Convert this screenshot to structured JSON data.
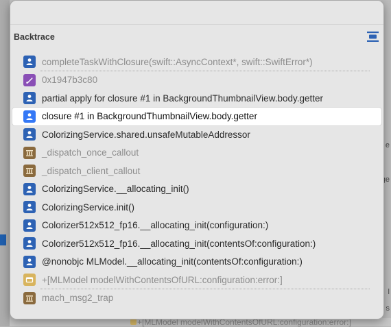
{
  "background": {
    "right_hints": [
      "e",
      "ge",
      "l",
      "s"
    ],
    "bottom_hint": "+[MLModel modelWithContentsOfURL:configuration:error:]"
  },
  "panel": {
    "title": "Backtrace",
    "toggle_icon": "expand-collapse-icon"
  },
  "frames": [
    {
      "label": "completeTaskWithClosure(swift::AsyncContext*, swift::SwiftError*)",
      "kind": "user",
      "dimmed": true,
      "separator_after": true
    },
    {
      "label": "0x1947b3c80",
      "kind": "asm",
      "dimmed": true
    },
    {
      "label": "partial apply for closure #1 in BackgroundThumbnailView.body.getter",
      "kind": "user",
      "dimmed": false
    },
    {
      "label": "closure #1 in BackgroundThumbnailView.body.getter",
      "kind": "user",
      "dimmed": false,
      "selected": true
    },
    {
      "label": "ColorizingService.shared.unsafeMutableAddressor",
      "kind": "user",
      "dimmed": false
    },
    {
      "label": "_dispatch_once_callout",
      "kind": "lib",
      "dimmed": true
    },
    {
      "label": "_dispatch_client_callout",
      "kind": "lib",
      "dimmed": true
    },
    {
      "label": "ColorizingService.__allocating_init()",
      "kind": "user",
      "dimmed": false
    },
    {
      "label": "ColorizingService.init()",
      "kind": "user",
      "dimmed": false
    },
    {
      "label": "Colorizer512x512_fp16.__allocating_init(configuration:)",
      "kind": "user",
      "dimmed": false
    },
    {
      "label": "Colorizer512x512_fp16.__allocating_init(contentsOf:configuration:)",
      "kind": "user",
      "dimmed": false
    },
    {
      "label": "@nonobjc MLModel.__allocating_init(contentsOf:configuration:)",
      "kind": "user",
      "dimmed": false
    },
    {
      "label": "+[MLModel modelWithContentsOfURL:configuration:error:]",
      "kind": "objc",
      "dimmed": true,
      "separator_after": true
    },
    {
      "label": "mach_msg2_trap",
      "kind": "lib",
      "dimmed": true
    }
  ],
  "colors": {
    "user": "#2d62b4",
    "user_selected": "#3478f6",
    "library": "#8a6a3e",
    "assembly": "#8a4fb6",
    "objc": "#d8b45e"
  }
}
